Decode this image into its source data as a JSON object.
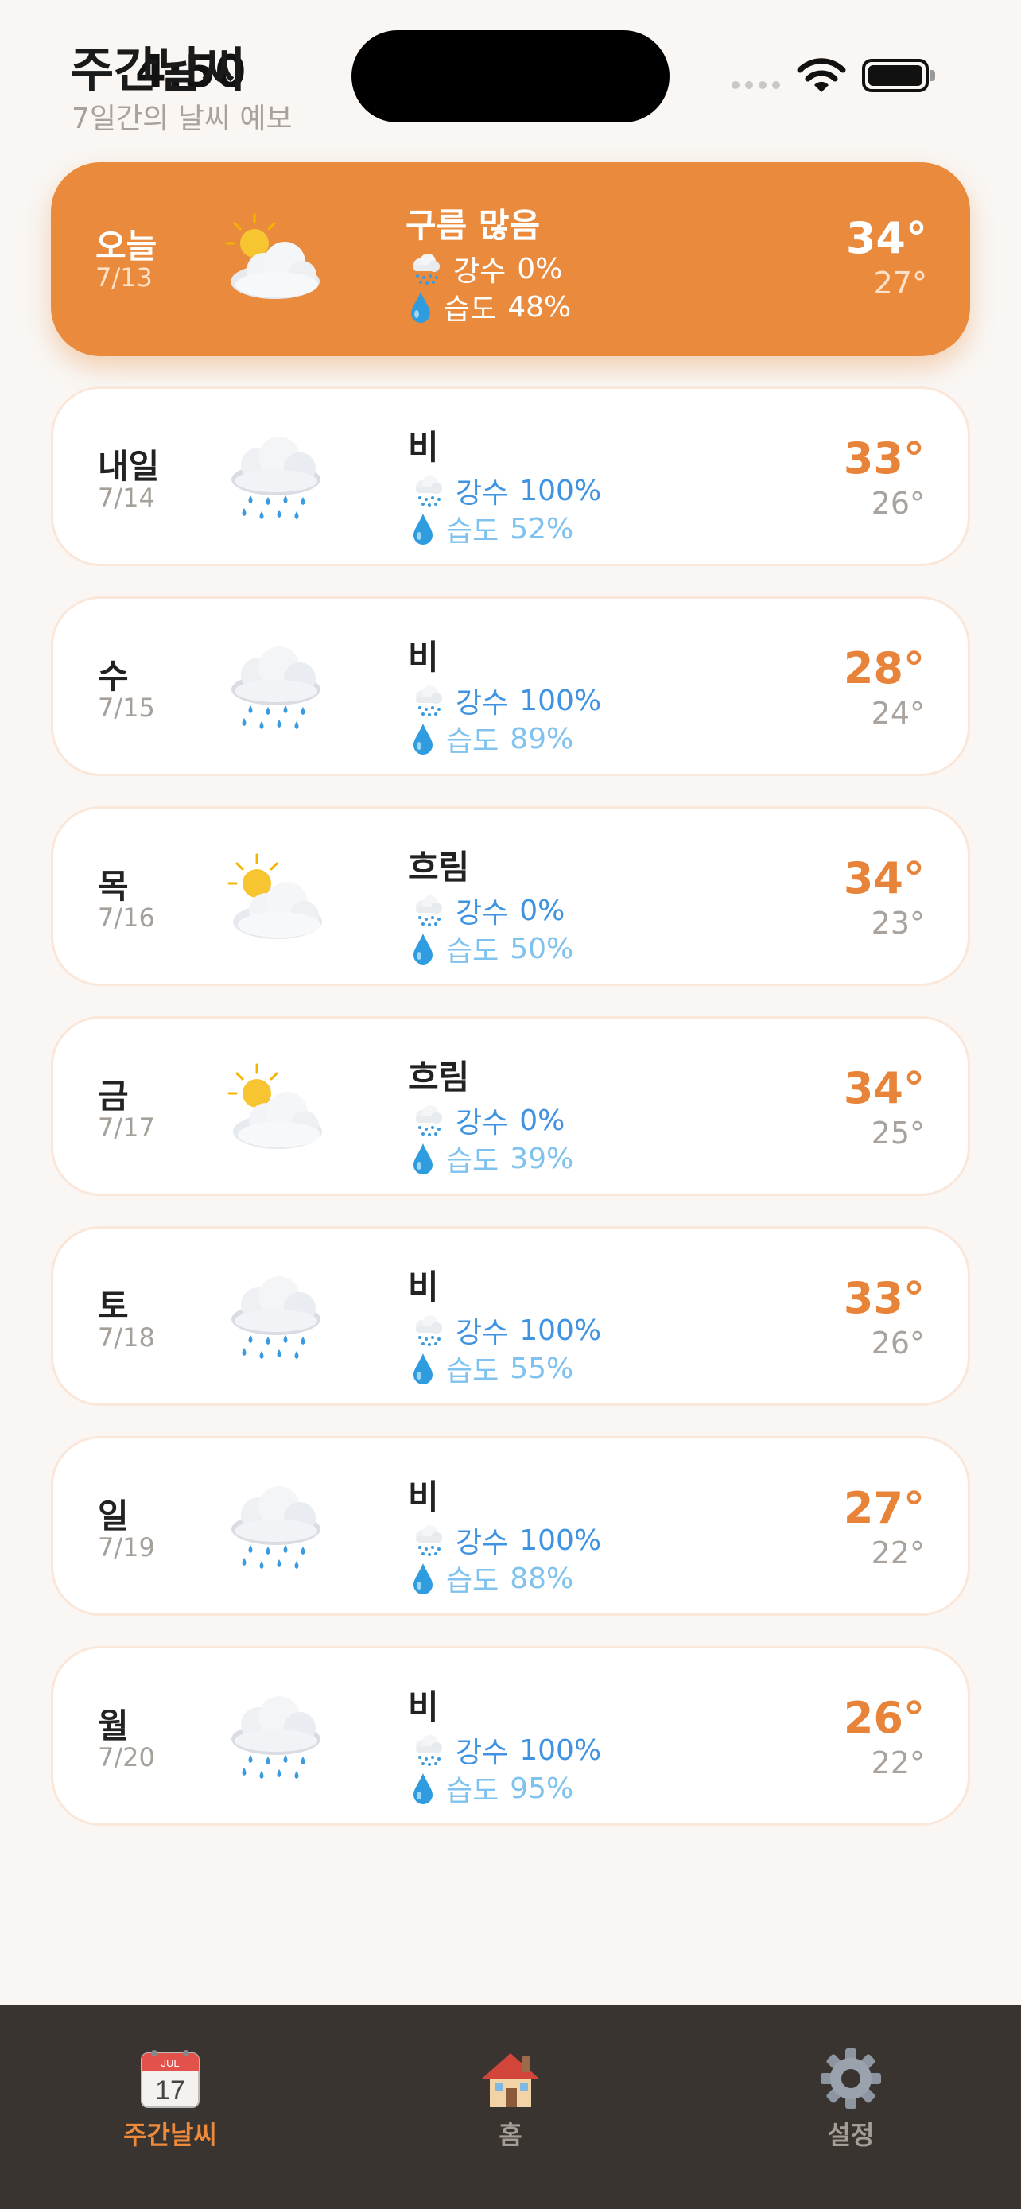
{
  "status_bar": {
    "time": "4:50"
  },
  "header": {
    "title": "주간날씨",
    "subtitle": "7일간의 날씨 예보"
  },
  "labels": {
    "precip": "강수",
    "humidity": "습도"
  },
  "colors": {
    "accent": "#e98a3c",
    "precip": "#3f93e0",
    "humidity": "#7fc2ee",
    "background": "#f9f6f3",
    "tabbar": "#3a3430"
  },
  "days": [
    {
      "day": "오늘",
      "date": "7/13",
      "condition": "구름 많음",
      "icon": "sun-behind-cloud-icon",
      "precip": "0%",
      "humidity": "48%",
      "high": "34°",
      "low": "27°",
      "today": true
    },
    {
      "day": "내일",
      "date": "7/14",
      "condition": "비",
      "icon": "rain-cloud-icon",
      "precip": "100%",
      "humidity": "52%",
      "high": "33°",
      "low": "26°"
    },
    {
      "day": "수",
      "date": "7/15",
      "condition": "비",
      "icon": "rain-cloud-icon",
      "precip": "100%",
      "humidity": "89%",
      "high": "28°",
      "low": "24°"
    },
    {
      "day": "목",
      "date": "7/16",
      "condition": "흐림",
      "icon": "sun-behind-cloud-icon",
      "precip": "0%",
      "humidity": "50%",
      "high": "34°",
      "low": "23°"
    },
    {
      "day": "금",
      "date": "7/17",
      "condition": "흐림",
      "icon": "sun-behind-cloud-icon",
      "precip": "0%",
      "humidity": "39%",
      "high": "34°",
      "low": "25°"
    },
    {
      "day": "토",
      "date": "7/18",
      "condition": "비",
      "icon": "rain-cloud-icon",
      "precip": "100%",
      "humidity": "55%",
      "high": "33°",
      "low": "26°"
    },
    {
      "day": "일",
      "date": "7/19",
      "condition": "비",
      "icon": "rain-cloud-icon",
      "precip": "100%",
      "humidity": "88%",
      "high": "27°",
      "low": "22°"
    },
    {
      "day": "월",
      "date": "7/20",
      "condition": "비",
      "icon": "rain-cloud-icon",
      "precip": "100%",
      "humidity": "95%",
      "high": "26°",
      "low": "22°"
    }
  ],
  "tabs": [
    {
      "label": "주간날씨",
      "icon": "calendar-icon",
      "calendar_month": "JUL",
      "calendar_day": "17",
      "active": true
    },
    {
      "label": "홈",
      "icon": "house-icon",
      "active": false
    },
    {
      "label": "설정",
      "icon": "gear-icon",
      "active": false
    }
  ]
}
